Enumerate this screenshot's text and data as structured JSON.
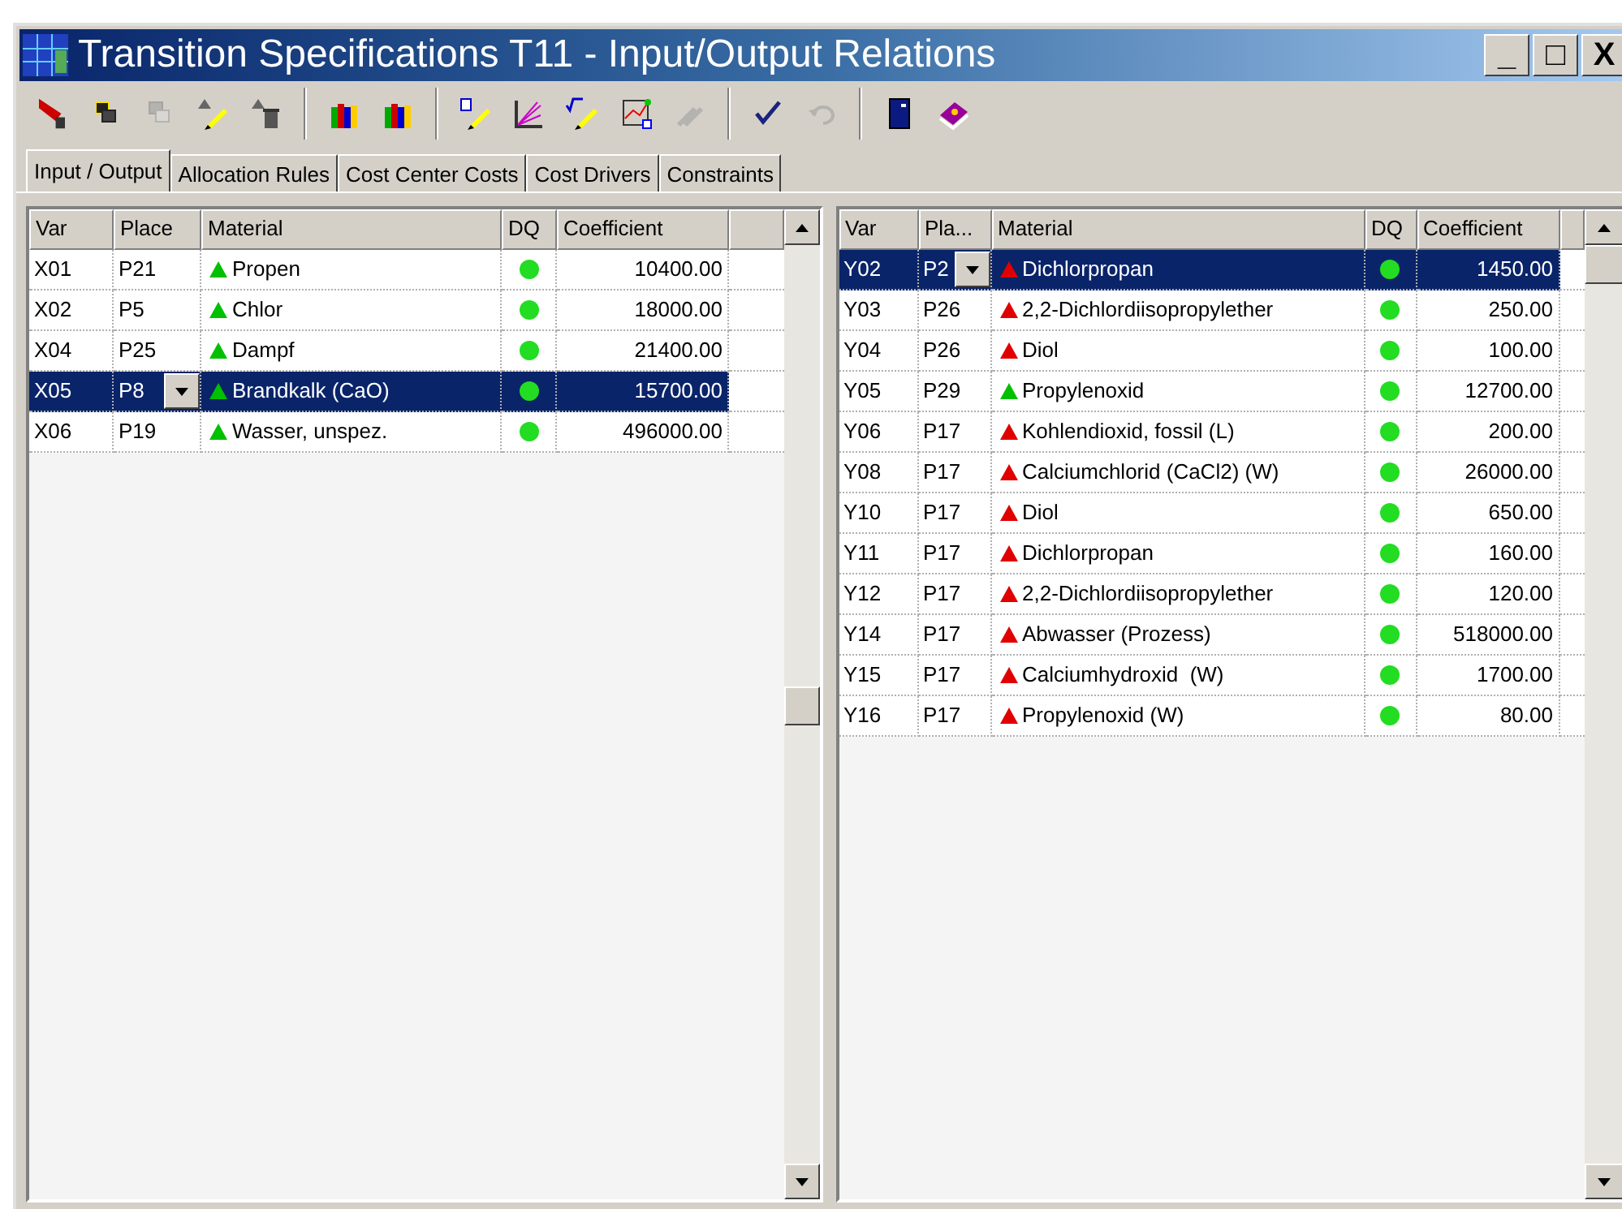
{
  "window": {
    "title": "Transition Specifications T11 - Input/Output Relations",
    "controls": [
      "_",
      "□",
      "X"
    ]
  },
  "toolbar": [
    {
      "kind": "cursor",
      "disabled": false
    },
    {
      "kind": "windows",
      "disabled": false
    },
    {
      "kind": "windows",
      "disabled": true
    },
    {
      "kind": "triangle-pen",
      "disabled": false
    },
    {
      "kind": "triangle-trash",
      "disabled": false
    },
    {
      "kind": "sep"
    },
    {
      "kind": "books",
      "disabled": false
    },
    {
      "kind": "books",
      "disabled": false
    },
    {
      "kind": "sep"
    },
    {
      "kind": "pen",
      "disabled": false
    },
    {
      "kind": "chart",
      "disabled": false
    },
    {
      "kind": "formula",
      "disabled": false
    },
    {
      "kind": "diagram",
      "disabled": false
    },
    {
      "kind": "tool",
      "disabled": true
    },
    {
      "kind": "sep"
    },
    {
      "kind": "check",
      "disabled": false
    },
    {
      "kind": "undo",
      "disabled": true
    },
    {
      "kind": "sep"
    },
    {
      "kind": "door",
      "disabled": false
    },
    {
      "kind": "book",
      "disabled": false
    }
  ],
  "tabs": [
    {
      "label": "Input / Output",
      "selected": true
    },
    {
      "label": "Allocation Rules",
      "selected": false
    },
    {
      "label": "Cost Center Costs",
      "selected": false
    },
    {
      "label": "Cost Drivers",
      "selected": false
    },
    {
      "label": "Constraints",
      "selected": false
    }
  ],
  "inputs": {
    "columns": [
      "Var",
      "Place",
      "Material",
      "DQ",
      "Coefficient"
    ],
    "rows": [
      {
        "var": "X01",
        "place": "P21",
        "material": "Propen",
        "color": "#00c000",
        "coefficient": "10400.00",
        "selected": false
      },
      {
        "var": "X02",
        "place": "P5",
        "material": "Chlor",
        "color": "#00c000",
        "coefficient": "18000.00",
        "selected": false
      },
      {
        "var": "X04",
        "place": "P25",
        "material": "Dampf",
        "color": "#00c000",
        "coefficient": "21400.00",
        "selected": false
      },
      {
        "var": "X05",
        "place": "P8",
        "material": "Brandkalk (CaO)",
        "color": "#00c000",
        "coefficient": "15700.00",
        "selected": true
      },
      {
        "var": "X06",
        "place": "P19",
        "material": "Wasser, unspez.",
        "color": "#00c000",
        "coefficient": "496000.00",
        "selected": false
      }
    ]
  },
  "outputs": {
    "columns": [
      "Var",
      "Pla...",
      "Material",
      "DQ",
      "Coefficient"
    ],
    "rows": [
      {
        "var": "Y02",
        "place": "P2",
        "material": "Dichlorpropan",
        "color": "#e00000",
        "coefficient": "1450.00",
        "selected": true
      },
      {
        "var": "Y03",
        "place": "P26",
        "material": "2,2-Dichlordiisopropylether",
        "color": "#e00000",
        "coefficient": "250.00",
        "selected": false
      },
      {
        "var": "Y04",
        "place": "P26",
        "material": "Diol",
        "color": "#e00000",
        "coefficient": "100.00",
        "selected": false
      },
      {
        "var": "Y05",
        "place": "P29",
        "material": "Propylenoxid",
        "color": "#00c000",
        "coefficient": "12700.00",
        "selected": false
      },
      {
        "var": "Y06",
        "place": "P17",
        "material": "Kohlendioxid, fossil (L)",
        "color": "#e00000",
        "coefficient": "200.00",
        "selected": false
      },
      {
        "var": "Y08",
        "place": "P17",
        "material": "Calciumchlorid (CaCl2) (W)",
        "color": "#e00000",
        "coefficient": "26000.00",
        "selected": false
      },
      {
        "var": "Y10",
        "place": "P17",
        "material": "Diol",
        "color": "#e00000",
        "coefficient": "650.00",
        "selected": false
      },
      {
        "var": "Y11",
        "place": "P17",
        "material": "Dichlorpropan",
        "color": "#e00000",
        "coefficient": "160.00",
        "selected": false
      },
      {
        "var": "Y12",
        "place": "P17",
        "material": "2,2-Dichlordiisopropylether",
        "color": "#e00000",
        "coefficient": "120.00",
        "selected": false
      },
      {
        "var": "Y14",
        "place": "P17",
        "material": "Abwasser (Prozess)",
        "color": "#e00000",
        "coefficient": "518000.00",
        "selected": false
      },
      {
        "var": "Y15",
        "place": "P17",
        "material": "Calciumhydroxid  (W)",
        "color": "#e00000",
        "coefficient": "1700.00",
        "selected": false
      },
      {
        "var": "Y16",
        "place": "P17",
        "material": "Propylenoxid (W)",
        "color": "#e00000",
        "coefficient": "80.00",
        "selected": false
      }
    ]
  }
}
